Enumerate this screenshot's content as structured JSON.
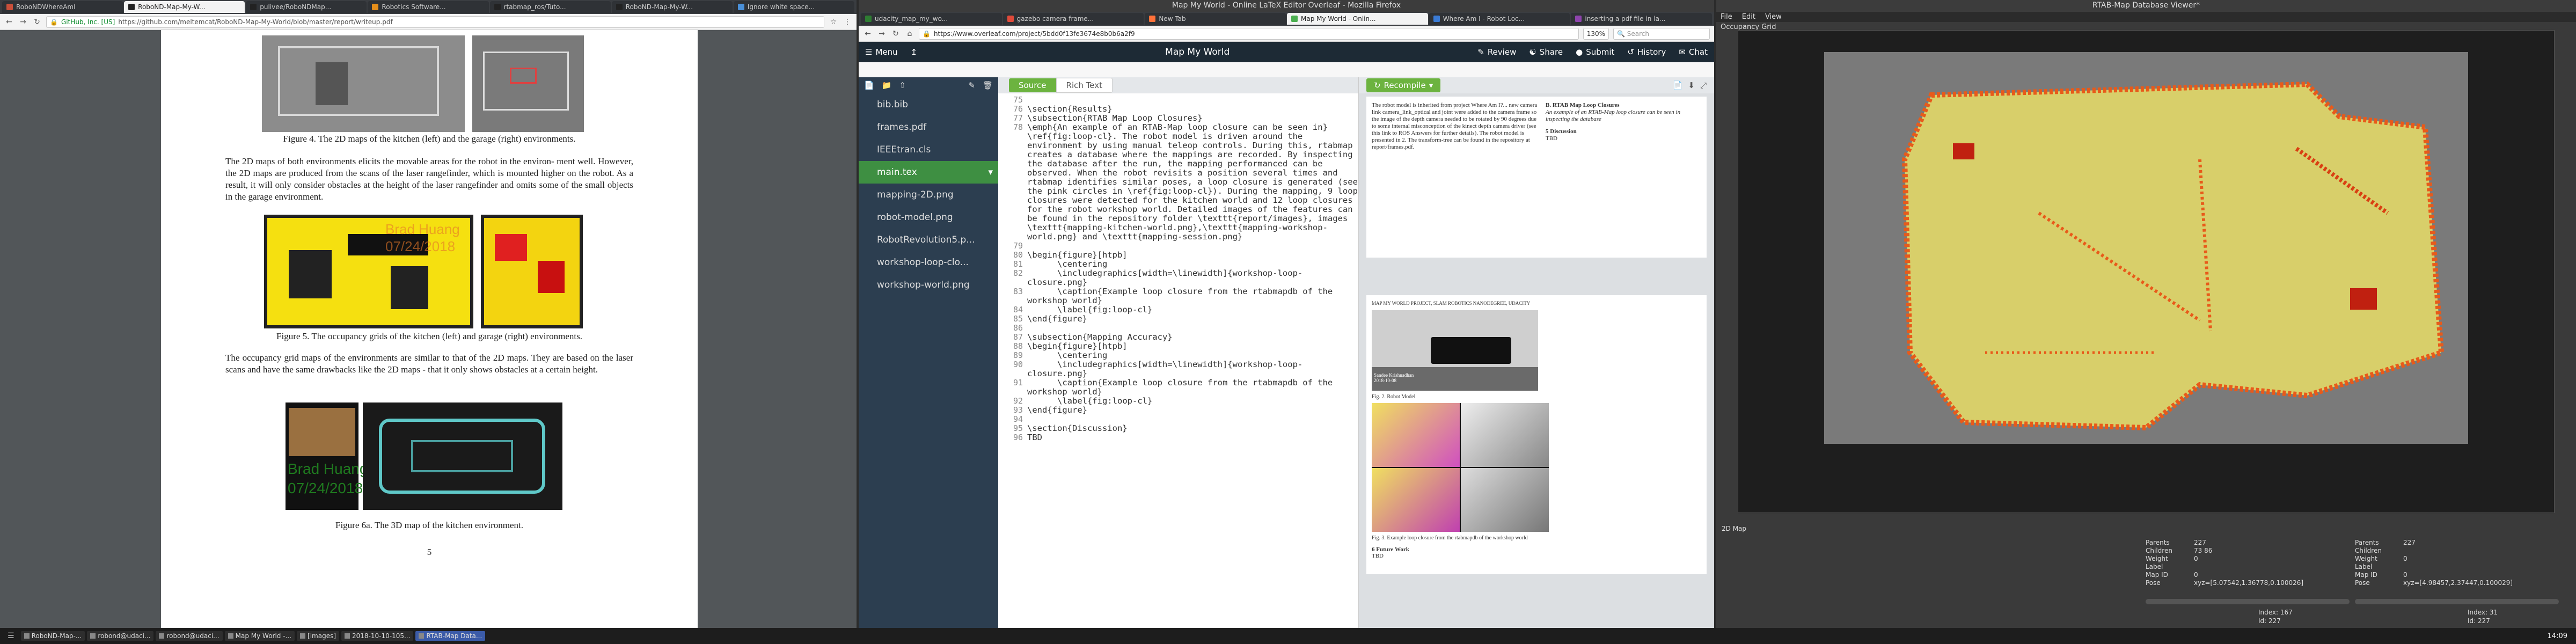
{
  "left_browser": {
    "tabs": [
      {
        "label": "RoboNDWhereAmI"
      },
      {
        "label": "RoboND-Map-My-W..."
      },
      {
        "label": "pulivee/RoboNDMap..."
      },
      {
        "label": "Robotics Software..."
      },
      {
        "label": "rtabmap_ros/Tuto..."
      },
      {
        "label": "RoboND-Map-My-W..."
      },
      {
        "label": "Ignore white space..."
      }
    ],
    "url_site": "GitHub, Inc. [US]",
    "url": "https://github.com/meltemcat/RoboND-Map-My-World/blob/master/report/writeup.pdf",
    "fig4_caption": "Figure 4.  The 2D maps of the kitchen (left) and the garage (right) environments.",
    "para1": "The 2D maps of both environments elicits the movable areas for the robot in the environ- ment well. However, the 2D maps are produced from the scans of the laser rangefinder, which is mounted higher on the robot. As a result, it will only consider obstacles at the height of the laser rangefinder and omits some of the small objects in the garage environment.",
    "watermark_name": "Brad Huang",
    "watermark_date": "07/24/2018",
    "fig5_caption": "Figure 5.  The occupancy grids of the kitchen (left) and garage (right) environments.",
    "para2": "The occupancy grid maps of the environments are similar to that of the 2D maps. They are based on the laser scans and have the same drawbacks like the 2D maps - that it only shows obstacles at a certain height.",
    "fig6_caption": "Figure 6a.  The 3D map of the kitchen environment.",
    "page_number": "5"
  },
  "overleaf": {
    "window_title": "Map My World - Online LaTeX Editor Overleaf - Mozilla Firefox",
    "tabs": [
      {
        "label": "udacity_map_my_wo..."
      },
      {
        "label": "gazebo camera frame..."
      },
      {
        "label": "New Tab"
      },
      {
        "label": "Map My World - Onlin..."
      },
      {
        "label": "Where Am I - Robot Loc..."
      },
      {
        "label": "inserting a pdf file in la..."
      }
    ],
    "url": "https://www.overleaf.com/project/5bdd0f13fe3674e8b0b6a2f9",
    "zoom": "130%",
    "search_placeholder": "Search",
    "menu_label": "Menu",
    "project_title": "Map My World",
    "review_label": "Review",
    "share_label": "Share",
    "submit_label": "Submit",
    "history_label": "History",
    "chat_label": "Chat",
    "source_label": "Source",
    "rich_label": "Rich Text",
    "recompile_label": "Recompile",
    "files": [
      {
        "name": "bib.bib"
      },
      {
        "name": "frames.pdf"
      },
      {
        "name": "IEEEtran.cls"
      },
      {
        "name": "main.tex"
      },
      {
        "name": "mapping-2D.png"
      },
      {
        "name": "robot-model.png"
      },
      {
        "name": "RobotRevolution5.p..."
      },
      {
        "name": "workshop-loop-clo..."
      },
      {
        "name": "workshop-world.png"
      }
    ],
    "code_lines": [
      {
        "n": "75",
        "t": ""
      },
      {
        "n": "76",
        "t": "\\section{Results}"
      },
      {
        "n": "77",
        "t": "\\subsection{RTAB Map Loop Closures}"
      },
      {
        "n": "78",
        "t": "\\emph{An example of an RTAB-Map loop closure can be seen in} \\ref{fig:loop-cl}. The robot model is driven around the environment by using manual teleop controls. During this, rtabmap creates a database where the mappings are recorded. By inspecting the database after the run, the mapping performanced can be observed. When the robot revisits a position several times and rtabmap identifies similar poses, a loop closure is generated (see the pink circles in \\ref{fig:loop-cl}). During the mapping, 9 loop closures were detected for the kitchen world and 12 loop closures for the robot workshop world. Detailed images of the features can be found in the repository folder \\texttt{report/images}, images \\texttt{mapping-kitchen-world.png},\\texttt{mapping-workshop-world.png} and \\texttt{mapping-session.png}"
      },
      {
        "n": "79",
        "t": ""
      },
      {
        "n": "80",
        "t": "\\begin{figure}[htpb]"
      },
      {
        "n": "81",
        "t": "      \\centering"
      },
      {
        "n": "82",
        "t": "      \\includegraphics[width=\\linewidth]{workshop-loop-closure.png}"
      },
      {
        "n": "83",
        "t": "      \\caption{Example loop closure from the rtabmapdb of the workshop world}"
      },
      {
        "n": "84",
        "t": "      \\label{fig:loop-cl}"
      },
      {
        "n": "85",
        "t": "\\end{figure}"
      },
      {
        "n": "86",
        "t": ""
      },
      {
        "n": "87",
        "t": "\\subsection{Mapping Accuracy}"
      },
      {
        "n": "88",
        "t": "\\begin{figure}[htpb]"
      },
      {
        "n": "89",
        "t": "      \\centering"
      },
      {
        "n": "90",
        "t": "      \\includegraphics[width=\\linewidth]{workshop-loop-closure.png}"
      },
      {
        "n": "91",
        "t": "      \\caption{Example loop closure from the rtabmapdb of the workshop world}"
      },
      {
        "n": "92",
        "t": "      \\label{fig:loop-cl}"
      },
      {
        "n": "93",
        "t": "\\end{figure}"
      },
      {
        "n": "94",
        "t": ""
      },
      {
        "n": "95",
        "t": "\\section{Discussion}"
      },
      {
        "n": "96",
        "t": "TBD"
      }
    ],
    "preview": {
      "top_text": "The robot model is inherited from project Where Am I?... new camera link camera_link_optical and joint were added to the camera frame so the image of the depth camera needed to be rotated by 90 degrees due to some internal misconception of the kinect depth camera driver (see this link to ROS Answers for further details). The robot model is presented in 2. The transform-tree can be found in the repository at report/frames.pdf.",
      "sec_b": "B.  RTAB Map Loop Closures",
      "sec_b_text": "An example of an RTAB-Map loop closure can be seen in inspecting the database",
      "sec_5": "5   Discussion",
      "tbd": "TBD",
      "header": "MAP MY WORLD PROJECT, SLAM ROBOTICS NANODEGREE, UDACITY",
      "fig2": "Fig. 2.  Robot Model",
      "fig3": "Fig. 3.  Example loop closure from the rtabmapdb of the workshop world",
      "sec_6": "6   Future Work",
      "tbd2": "TBD",
      "robot_stamp": "Sandee Krishnadhan 2018-10-08"
    }
  },
  "rtab": {
    "window_title": "RTAB-Map Database Viewer*",
    "menu": [
      {
        "label": "File"
      },
      {
        "label": "Edit"
      },
      {
        "label": "View"
      }
    ],
    "panel_title": "Occupancy Grid",
    "bottom_label": "2D Map",
    "left_info": [
      {
        "k": "Parents",
        "v": "227"
      },
      {
        "k": "Children",
        "v": "73 86"
      },
      {
        "k": "Weight",
        "v": "0"
      },
      {
        "k": "Label",
        "v": ""
      },
      {
        "k": "Map ID",
        "v": "0"
      },
      {
        "k": "Pose",
        "v": "xyz=[5.07542,1.36778,0.100026]"
      }
    ],
    "right_info": [
      {
        "k": "Parents",
        "v": "227"
      },
      {
        "k": "Children",
        "v": ""
      },
      {
        "k": "Weight",
        "v": "0"
      },
      {
        "k": "Label",
        "v": ""
      },
      {
        "k": "Map ID",
        "v": "0"
      },
      {
        "k": "Pose",
        "v": "xyz=[4.98457,2.37447,0.100029]"
      }
    ],
    "left_index": "Index: 167",
    "left_id": "Id: 227",
    "right_index": "Index: 31",
    "right_id": "Id: 227"
  },
  "taskbar": {
    "items": [
      {
        "label": "RoboND-Map-..."
      },
      {
        "label": "robond@udaci..."
      },
      {
        "label": "robond@udaci..."
      },
      {
        "label": "Map My World -..."
      },
      {
        "label": "[images]"
      },
      {
        "label": "2018-10-10-105..."
      },
      {
        "label": "RTAB-Map Data..."
      }
    ],
    "clock": "14:09"
  }
}
